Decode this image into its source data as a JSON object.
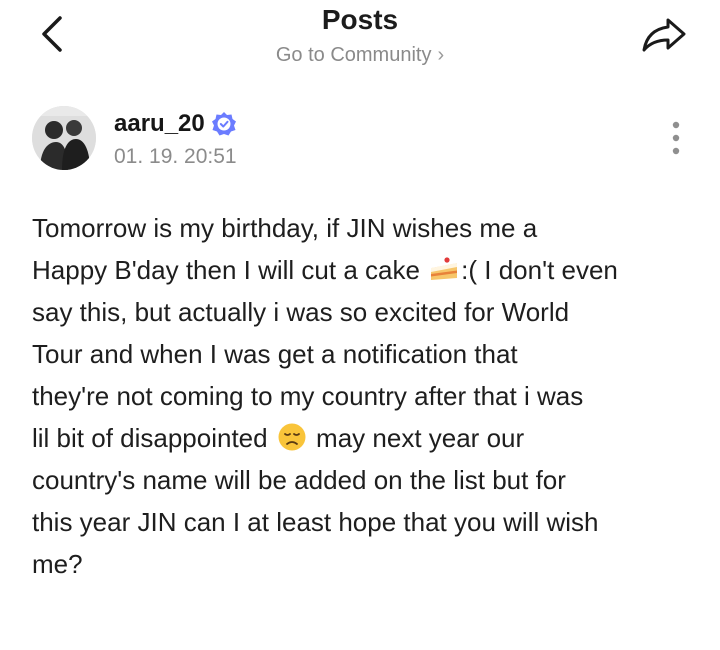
{
  "header": {
    "title": "Posts",
    "community_link": "Go to Community",
    "chevron": "›"
  },
  "post": {
    "author": "aaru_20",
    "timestamp": "01. 19. 20:51",
    "text_parts": [
      "Tomorrow is my birthday, if JIN wishes me a\nHappy B'day then I will cut a cake ",
      ":( I don't even\nsay this, but actually i was so excited for World\nTour and when I was get a notification that\nthey're not coming to my country after that i was\nlil bit of disappointed ",
      " may next year our\ncountry's name will be added on the list but for\nthis year JIN can I at least hope that you will wish\nme?"
    ]
  },
  "icons": {
    "back": "chevron-left-icon",
    "share": "share-arrow-icon",
    "more": "more-vertical-icon",
    "verified": "verified-badge-icon",
    "cake": "cake-slice-emoji",
    "sad": "disappointed-face-emoji"
  },
  "colors": {
    "verified_badge": "#6b7cff",
    "text": "#1e1e1e",
    "muted": "#8b8b8b"
  }
}
